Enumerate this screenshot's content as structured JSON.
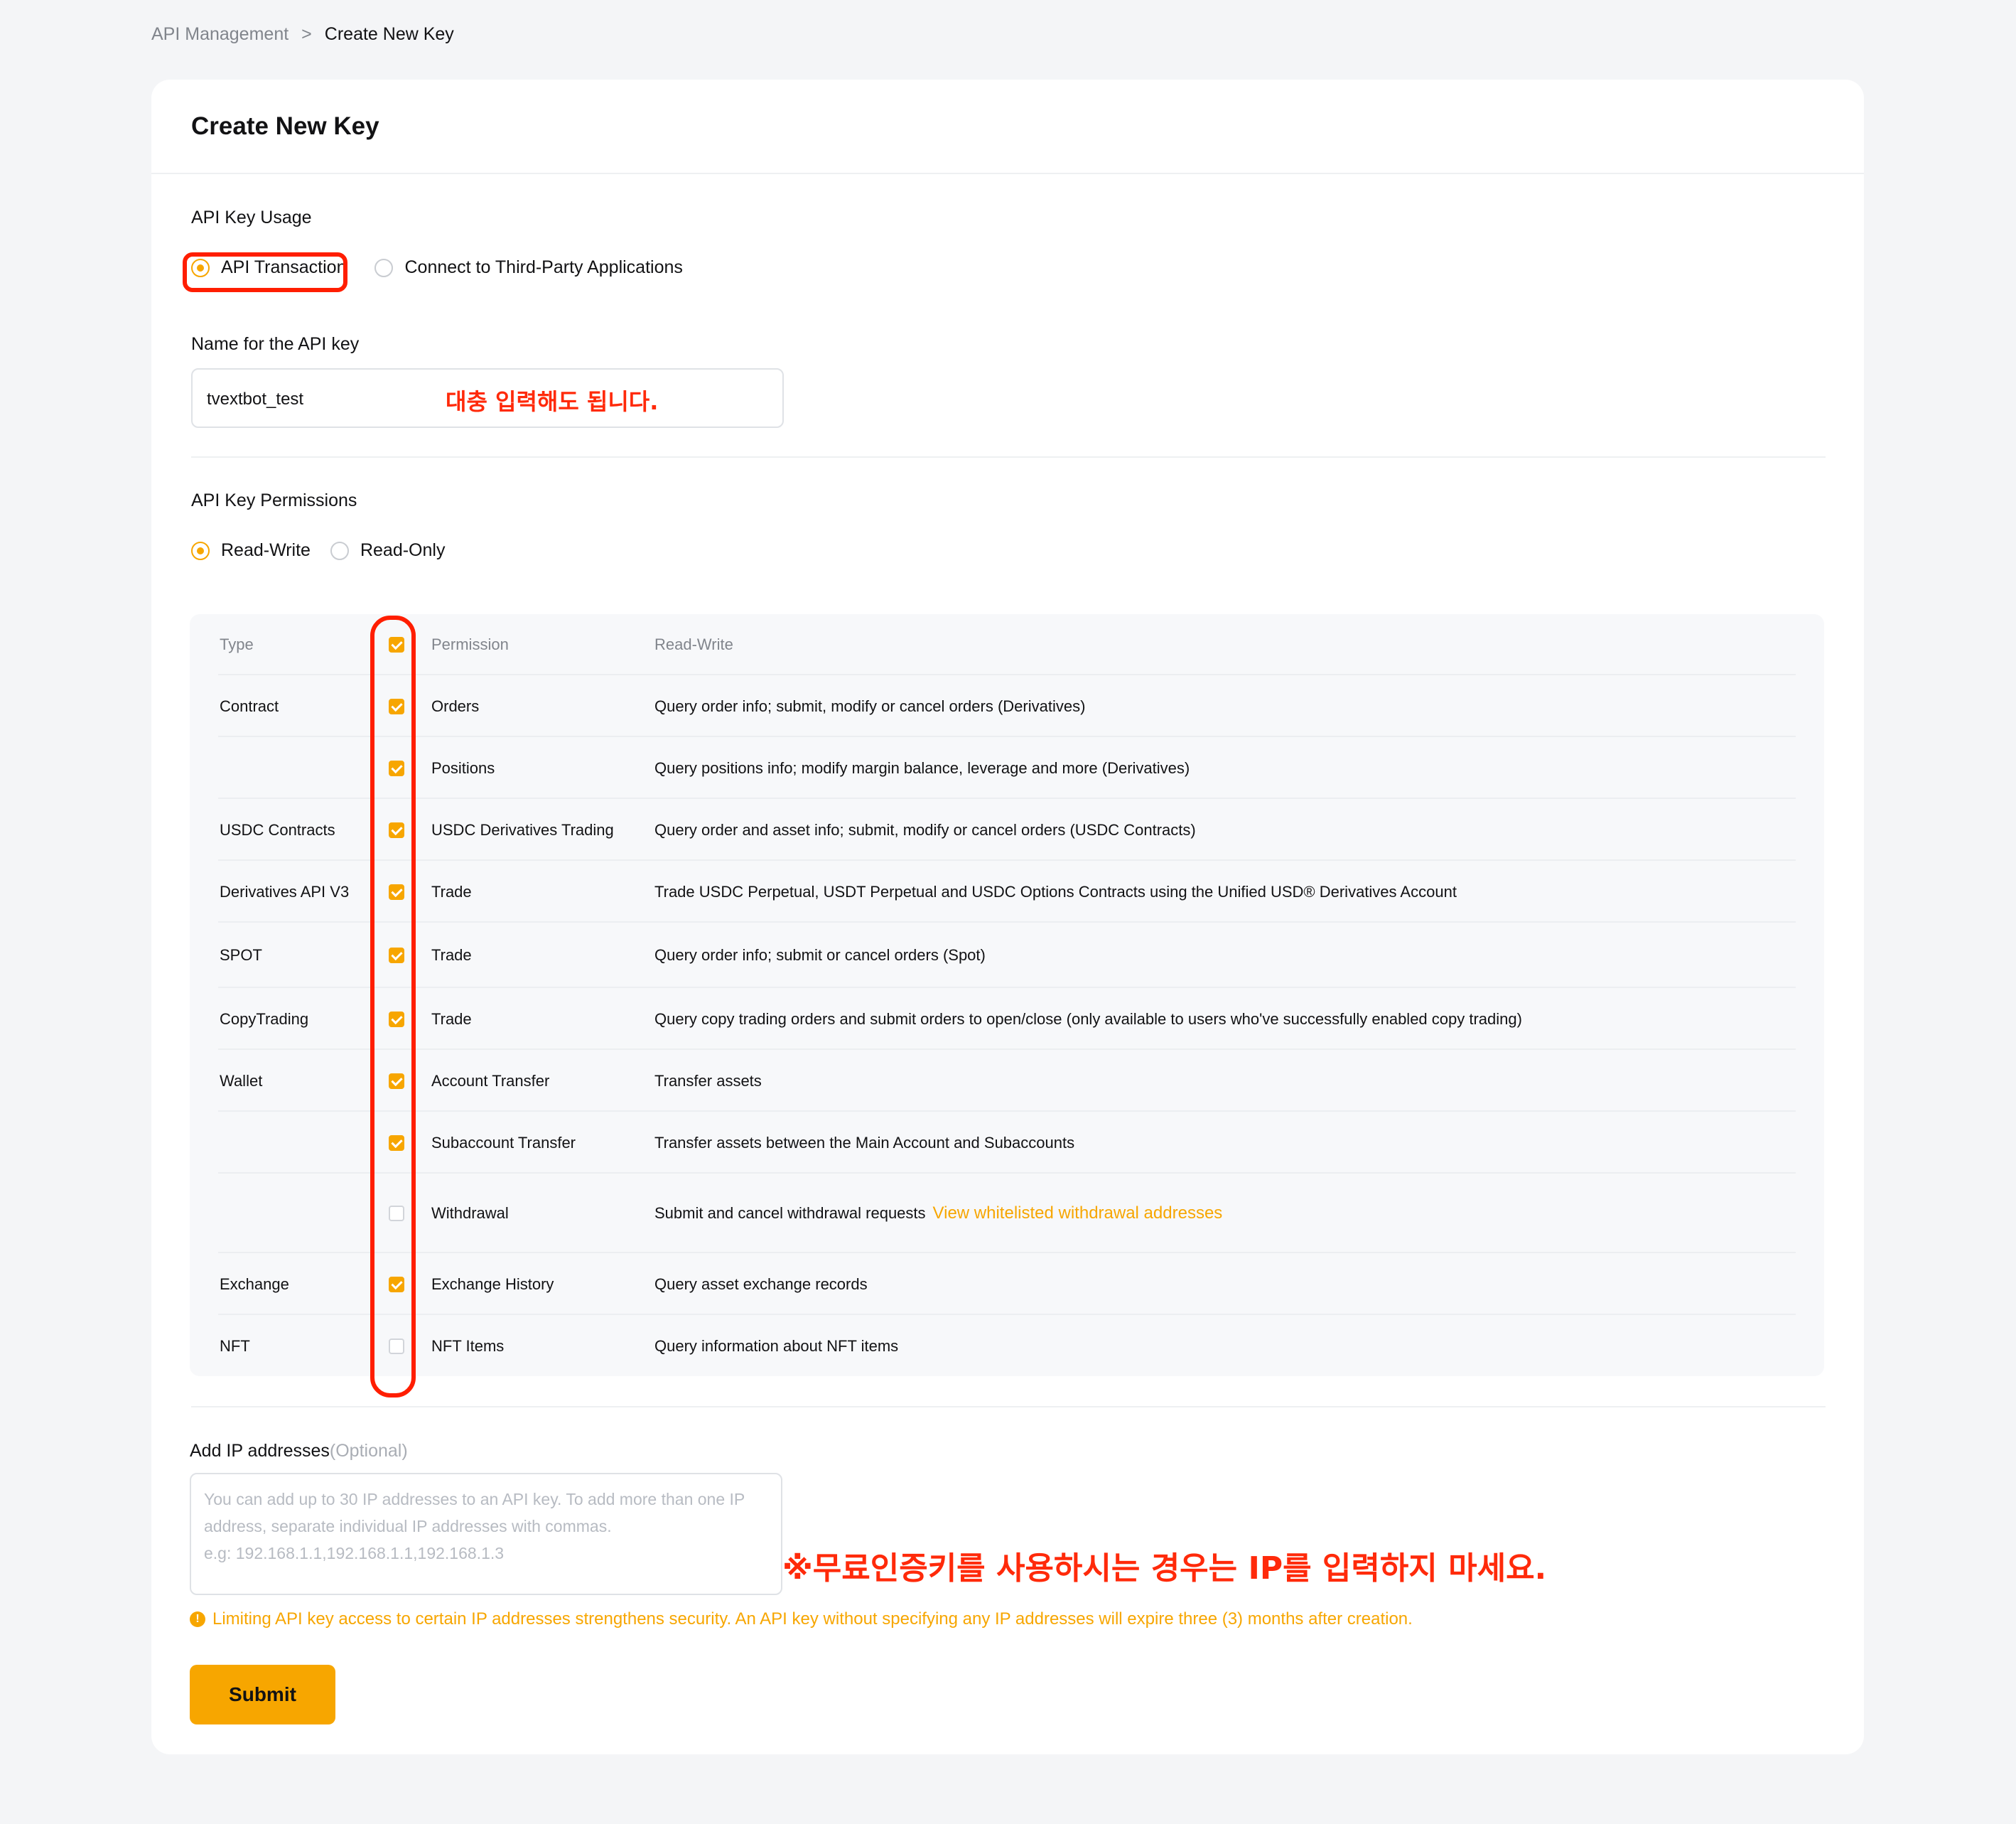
{
  "breadcrumb": {
    "parent": "API Management",
    "separator": ">",
    "current": "Create New Key"
  },
  "card": {
    "title": "Create New Key"
  },
  "usage": {
    "label": "API Key Usage",
    "options": [
      {
        "label": "API Transaction",
        "selected": true
      },
      {
        "label": "Connect to Third-Party Applications",
        "selected": false
      }
    ]
  },
  "name_field": {
    "label": "Name for the API key",
    "value": "tvextbot_test",
    "annotation": "대충 입력해도 됩니다."
  },
  "permissions": {
    "label": "API Key Permissions",
    "options": [
      {
        "label": "Read-Write",
        "selected": true
      },
      {
        "label": "Read-Only",
        "selected": false
      }
    ],
    "header": {
      "type": "Type",
      "permission": "Permission",
      "rw": "Read-Write",
      "all_checked": true
    },
    "rows": [
      {
        "type": "Contract",
        "checked": true,
        "permission": "Orders",
        "desc": "Query order info; submit, modify or cancel orders (Derivatives)"
      },
      {
        "type": "",
        "checked": true,
        "permission": "Positions",
        "desc": "Query positions info; modify margin balance, leverage and more (Derivatives)"
      },
      {
        "type": "USDC Contracts",
        "checked": true,
        "permission": "USDC Derivatives Trading",
        "desc": "Query order and asset info; submit, modify or cancel orders (USDC Contracts)"
      },
      {
        "type": "Derivatives API V3",
        "checked": true,
        "permission": "Trade",
        "desc": "Trade USDC Perpetual, USDT Perpetual and USDC Options Contracts using the Unified USD® Derivatives Account"
      },
      {
        "type": "SPOT",
        "checked": true,
        "permission": "Trade",
        "desc": "Query order info; submit or cancel orders (Spot)"
      },
      {
        "type": "CopyTrading",
        "checked": true,
        "permission": "Trade",
        "desc": "Query copy trading orders and submit orders to open/close (only available to users who've successfully enabled copy trading)"
      },
      {
        "type": "Wallet",
        "checked": true,
        "permission": "Account Transfer",
        "desc": "Transfer assets"
      },
      {
        "type": "",
        "checked": true,
        "permission": "Subaccount Transfer",
        "desc": "Transfer assets between the Main Account and Subaccounts"
      },
      {
        "type": "",
        "checked": false,
        "permission": "Withdrawal",
        "desc": "Submit and cancel withdrawal requests",
        "link": "View whitelisted withdrawal addresses"
      },
      {
        "type": "Exchange",
        "checked": true,
        "permission": "Exchange History",
        "desc": "Query asset exchange records"
      },
      {
        "type": "NFT",
        "checked": false,
        "permission": "NFT Items",
        "desc": "Query information about NFT items"
      }
    ]
  },
  "ip": {
    "label": "Add IP addresses",
    "optional": "(Optional)",
    "placeholder": "You can add up to 30 IP addresses to an API key. To add more than one IP address, separate individual IP addresses with commas.\ne.g: 192.168.1.1,192.168.1.1,192.168.1.3",
    "annotation": "※무료인증키를 사용하시는 경우는 IP를 입력하지 마세요.",
    "warning": "Limiting API key access to certain IP addresses strengthens security. An API key without specifying any IP addresses will expire three (3) months after creation."
  },
  "submit_label": "Submit",
  "colors": {
    "accent": "#f7a600",
    "highlight_red": "#ff1e00",
    "background": "#f4f5f7"
  }
}
